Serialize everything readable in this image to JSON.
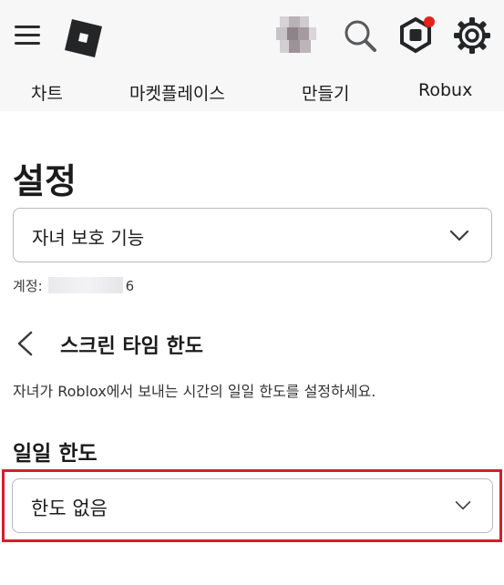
{
  "header": {
    "nav_tabs": [
      {
        "label": "차트"
      },
      {
        "label": "마켓플레이스"
      },
      {
        "label": "만들기"
      },
      {
        "label": "Robux"
      }
    ],
    "icons": [
      "menu-icon",
      "roblox-logo",
      "avatar",
      "search-icon",
      "robux-icon",
      "gear-icon"
    ],
    "notification_dot_color": "#e2231a"
  },
  "settings": {
    "title": "설정",
    "category_select": {
      "value": "자녀 보호 기능"
    },
    "account_label": "계정:",
    "account_suffix": "6"
  },
  "screen_time": {
    "title": "스크린 타임 한도",
    "description": "자녀가 Roblox에서 보내는 시간의 일일 한도를 설정하세요.",
    "daily_limit_label": "일일 한도",
    "daily_limit_select": {
      "value": "한도 없음"
    }
  },
  "colors": {
    "highlight": "#d1202b",
    "topbar_bg": "#f7f7f8"
  }
}
